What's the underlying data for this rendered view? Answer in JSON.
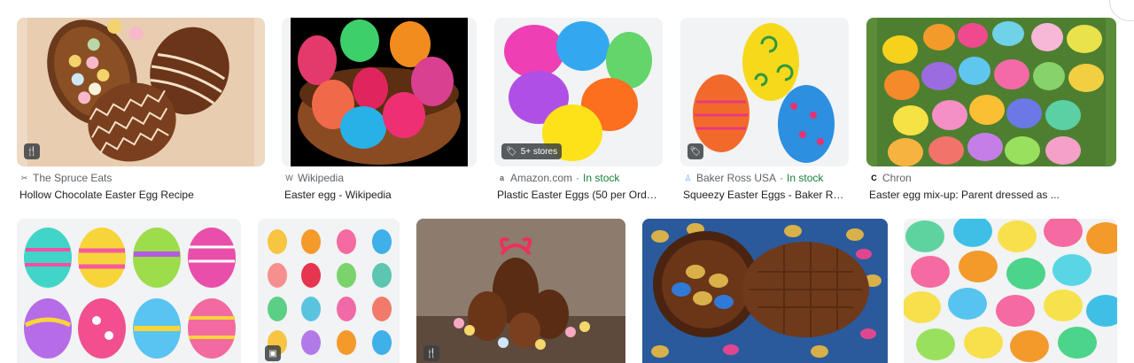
{
  "results_row1": [
    {
      "source": "The Spruce Eats",
      "title": "Hollow Chocolate Easter Egg Recipe",
      "favicon": "utensils-icon",
      "badge": "recipe"
    },
    {
      "source": "Wikipedia",
      "title": "Easter egg - Wikipedia",
      "favicon": "W"
    },
    {
      "source": "Amazon.com",
      "stock": "In stock",
      "title": "Plastic Easter Eggs (50 per Order)...",
      "favicon": "a",
      "badge_text": "5+ stores"
    },
    {
      "source": "Baker Ross USA",
      "stock": "In stock",
      "title": "Squeezy Easter Eggs - Baker Ross",
      "favicon": "baker-ross-icon",
      "badge": "product"
    },
    {
      "source": "Chron",
      "title": "Easter egg mix-up: Parent dressed as ...",
      "favicon": "C"
    }
  ],
  "separator": "·",
  "colors": {
    "accent_green": "#188038",
    "muted": "#5f6368",
    "text": "#202124"
  }
}
